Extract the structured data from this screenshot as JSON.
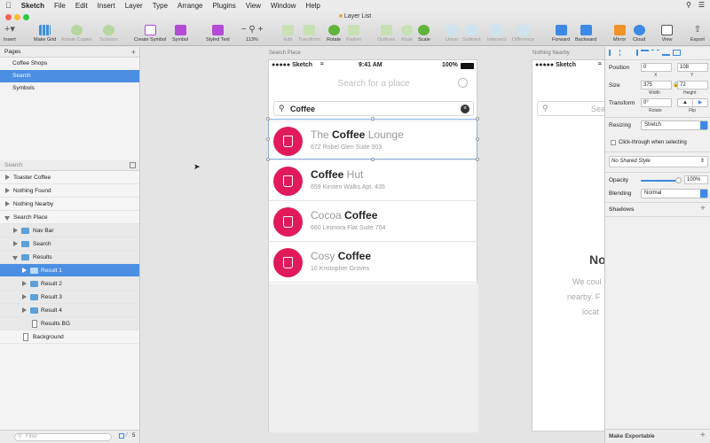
{
  "menubar": {
    "app": "Sketch",
    "items": [
      "File",
      "Edit",
      "Insert",
      "Layer",
      "Type",
      "Arrange",
      "Plugins",
      "View",
      "Window",
      "Help"
    ]
  },
  "window": {
    "title": "Layer List"
  },
  "toolbar": {
    "insert": "Insert",
    "make_grid": "Make Grid",
    "rotate_copies": "Rotate Copies",
    "scissors": "Scissors",
    "create_symbol": "Create Symbol",
    "symbol": "Symbol",
    "styled_text": "Styled Text",
    "zoom": "113%",
    "edit": "Edit",
    "transform": "Transform",
    "rotate": "Rotate",
    "flatten": "Flatten",
    "outlines": "Outlines",
    "mask": "Mask",
    "scale": "Scale",
    "union": "Union",
    "subtract": "Subtract",
    "intersect": "Intersect",
    "difference": "Difference",
    "forward": "Forward",
    "backward": "Backward",
    "mirror": "Mirror",
    "cloud": "Cloud",
    "view": "View",
    "export": "Export"
  },
  "pages": {
    "header": "Pages",
    "items": [
      "Coffee Shops",
      "Search",
      "Symbols"
    ],
    "selected": "Search"
  },
  "layers": {
    "search_placeholder": "Search",
    "items": [
      "Toaster Coffee",
      "Nothing Found",
      "Nothing Nearby",
      "Search Place",
      "Nav Bar",
      "Search",
      "Results",
      "Result 1",
      "Result 2",
      "Result 3",
      "Result 4",
      "Results BG",
      "Background"
    ],
    "selected": "Result 1",
    "filter_placeholder": "Filter",
    "footer_count": "5"
  },
  "artboard": {
    "name": "Search Place",
    "carrier": "●●●●● Sketch",
    "time": "9:41 AM",
    "battery": "100%",
    "nav_title": "Search for a place",
    "search_value": "Coffee",
    "results": [
      {
        "pre": "The ",
        "bold": "Coffee",
        "post": " Lounge",
        "address": "672 Robel Glen Suite 003"
      },
      {
        "pre": "",
        "bold": "Coffee",
        "post": " Hut",
        "address": "659 Kirsten Walks Apt. 435"
      },
      {
        "pre": "Cocoa ",
        "bold": "Coffee",
        "post": "",
        "address": "660 Leonora Flat Suite 764"
      },
      {
        "pre": "Cosy ",
        "bold": "Coffee",
        "post": "",
        "address": "10 Kristopher Groves"
      }
    ]
  },
  "artboard2": {
    "name": "Nothing Nearby",
    "carrier": "●●●●● Sketch",
    "search_partial": "Sear",
    "heading_partial": "No",
    "body_lines": [
      "We coul",
      "nearby. F",
      "locat"
    ]
  },
  "inspector": {
    "position_label": "Position",
    "x": "0",
    "y": "108",
    "x_label": "X",
    "y_label": "Y",
    "size_label": "Size",
    "width": "375",
    "height": "72",
    "width_label": "Width",
    "height_label": "Height",
    "transform_label": "Transform",
    "rotate": "0°",
    "rotate_label": "Rotate",
    "flip_label": "Flip",
    "resizing_label": "Resizing",
    "resizing_value": "Stretch",
    "clickthrough": "Click-through when selecting",
    "shared_style": "No Shared Style",
    "opacity_label": "Opacity",
    "opacity": "100%",
    "blending_label": "Blending",
    "blending": "Normal",
    "shadows": "Shadows",
    "make_exportable": "Make Exportable"
  },
  "colors": {
    "accent": "#e11a5a",
    "selection": "#4a8fe2"
  }
}
